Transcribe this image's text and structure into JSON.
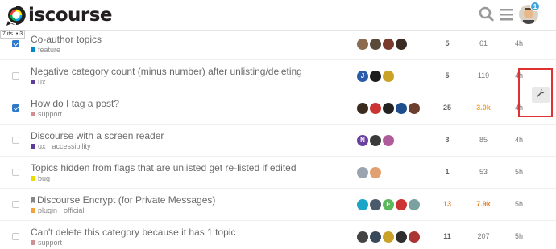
{
  "header": {
    "logo_text": "iscourse",
    "notification_count": "1"
  },
  "tooltip": {
    "left": "7 its",
    "right": "• 3"
  },
  "topics": [
    {
      "title": "Co-author topics",
      "checked": true,
      "categories": [
        {
          "name": "feature",
          "color": "#0088cc"
        }
      ],
      "tags": [],
      "posters": [
        "#8c6b4f",
        "#5a4a3a",
        "#7a3b2e",
        "#3b2b22"
      ],
      "replies": "5",
      "views": "61",
      "activity": "4h",
      "views_hot": false,
      "replies_hot": false
    },
    {
      "title": "Negative category count (minus number) after unlisting/deleting",
      "checked": false,
      "categories": [
        {
          "name": "ux",
          "color": "#5e3c99"
        }
      ],
      "tags": [],
      "posters": [
        "#2a5aa8",
        "#1d1d1d",
        "#c9a227"
      ],
      "poster_letters": [
        "J",
        "",
        ""
      ],
      "replies": "5",
      "views": "119",
      "activity": "4h",
      "views_hot": false,
      "replies_hot": false
    },
    {
      "title": "How do I tag a post?",
      "checked": true,
      "categories": [
        {
          "name": "support",
          "color": "#ce9090"
        }
      ],
      "tags": [],
      "posters": [
        "#3a2a20",
        "#cc3333",
        "#222222",
        "#1e4e8c",
        "#6b3e2e"
      ],
      "replies": "25",
      "views": "3.0k",
      "activity": "4h",
      "views_hot": true,
      "replies_hot": false
    },
    {
      "title": "Discourse with a screen reader",
      "checked": false,
      "categories": [
        {
          "name": "ux",
          "color": "#5e3c99"
        }
      ],
      "tags": [
        "accessibility"
      ],
      "posters": [
        "#6a3fa0",
        "#3a3a3a",
        "#b05c9a"
      ],
      "poster_letters": [
        "N",
        "",
        ""
      ],
      "replies": "3",
      "views": "85",
      "activity": "4h",
      "views_hot": false,
      "replies_hot": false
    },
    {
      "title": "Topics hidden from flags that are unlisted get re-listed if edited",
      "checked": false,
      "categories": [
        {
          "name": "bug",
          "color": "#e9dd00"
        }
      ],
      "tags": [],
      "posters": [
        "#9aa4b0",
        "#e0a070"
      ],
      "replies": "1",
      "views": "53",
      "activity": "5h",
      "views_hot": false,
      "replies_hot": false
    },
    {
      "title": "Discourse Encrypt (for Private Messages)",
      "checked": false,
      "pinned": true,
      "categories": [
        {
          "name": "plugin",
          "color": "#f2a33a"
        }
      ],
      "tags": [
        "official"
      ],
      "posters": [
        "#1aa5c9",
        "#4a5a6a",
        "#5cb85c",
        "#cc3333",
        "#7aa0a0"
      ],
      "poster_letters": [
        "",
        "",
        "E",
        "",
        ""
      ],
      "replies": "13",
      "views": "7.9k",
      "activity": "5h",
      "views_hot": true,
      "replies_hot": true
    },
    {
      "title": "Can't delete this category because it has 1 topic",
      "checked": false,
      "categories": [
        {
          "name": "support",
          "color": "#ce9090"
        }
      ],
      "tags": [],
      "posters": [
        "#444444",
        "#3a4a5a",
        "#c9a227",
        "#2e2e2e",
        "#aa3333"
      ],
      "replies": "11",
      "views": "207",
      "activity": "5h",
      "views_hot": false,
      "replies_hot": false
    }
  ]
}
